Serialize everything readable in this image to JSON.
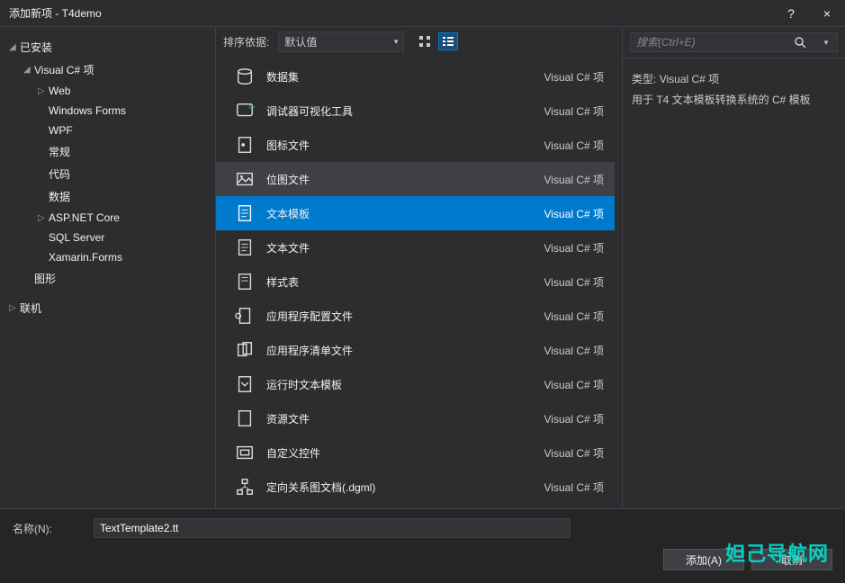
{
  "window": {
    "title": "添加新项 - T4demo",
    "help": "?",
    "close": "×"
  },
  "tree": {
    "installed": "已安装",
    "vcs": "Visual C# 项",
    "web": "Web",
    "winforms": "Windows Forms",
    "wpf": "WPF",
    "general": "常规",
    "code": "代码",
    "data": "数据",
    "aspnet": "ASP.NET Core",
    "sql": "SQL Server",
    "xamarin": "Xamarin.Forms",
    "graphics": "图形",
    "online": "联机"
  },
  "toolbar": {
    "sortby_label": "排序依据:",
    "sort_value": "默认值"
  },
  "search": {
    "placeholder": "搜索(Ctrl+E)"
  },
  "suffix": "Visual C# 项",
  "templates": [
    {
      "id": "dataset",
      "label": "数据集"
    },
    {
      "id": "dbgviz",
      "label": "调试器可视化工具"
    },
    {
      "id": "iconfile",
      "label": "图标文件"
    },
    {
      "id": "bitmap",
      "label": "位图文件"
    },
    {
      "id": "texttemplate",
      "label": "文本模板"
    },
    {
      "id": "textfile",
      "label": "文本文件"
    },
    {
      "id": "stylesheet",
      "label": "样式表"
    },
    {
      "id": "appconfig",
      "label": "应用程序配置文件"
    },
    {
      "id": "appmanifest",
      "label": "应用程序清单文件"
    },
    {
      "id": "runtimetext",
      "label": "运行时文本模板"
    },
    {
      "id": "resource",
      "label": "资源文件"
    },
    {
      "id": "customctrl",
      "label": "自定义控件"
    },
    {
      "id": "dgml",
      "label": "定向关系图文档(.dgml)"
    }
  ],
  "selected_template": "texttemplate",
  "hover_template": "bitmap",
  "details": {
    "type_label": "类型:",
    "type_value": "Visual C# 项",
    "description": "用于 T4 文本模板转换系统的 C# 模板"
  },
  "footer": {
    "name_label": "名称(N):",
    "name_value": "TextTemplate2.tt",
    "add": "添加(A)",
    "cancel": "取消"
  },
  "watermark": "妲己导航网"
}
